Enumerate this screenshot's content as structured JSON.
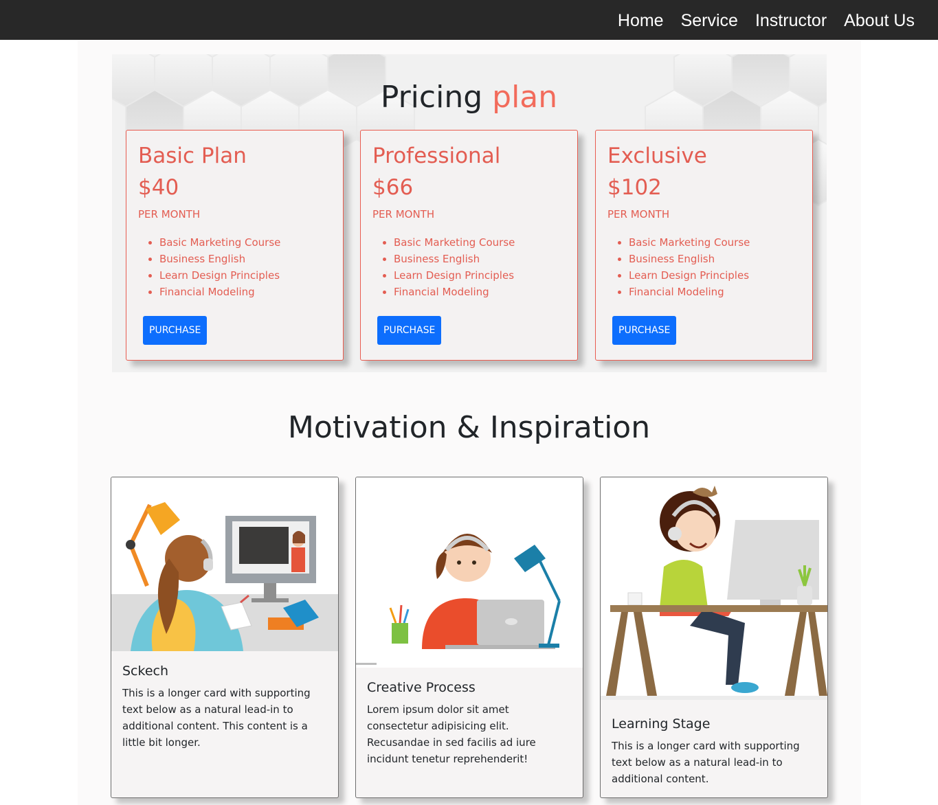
{
  "nav": {
    "items": [
      {
        "label": "Home"
      },
      {
        "label": "Service"
      },
      {
        "label": "Instructor"
      },
      {
        "label": "About Us"
      }
    ]
  },
  "pricing": {
    "title_main": "Pricing",
    "title_accent": "plan",
    "accent_color": "#f26b5b",
    "plans": [
      {
        "name": "Basic Plan",
        "price": "$40",
        "period": "PER MONTH",
        "features": [
          "Basic Marketing Course",
          "Business English",
          "Learn Design Principles",
          "Financial Modeling"
        ],
        "button_label": "PURCHASE"
      },
      {
        "name": "Professional",
        "price": "$66",
        "period": "PER MONTH",
        "features": [
          "Basic Marketing Course",
          "Business English",
          "Learn Design Principles",
          "Financial Modeling"
        ],
        "button_label": "PURCHASE"
      },
      {
        "name": "Exclusive",
        "price": "$102",
        "period": "PER MONTH",
        "features": [
          "Basic Marketing Course",
          "Business English",
          "Learn Design Principles",
          "Financial Modeling"
        ],
        "button_label": "PURCHASE"
      }
    ]
  },
  "motivation": {
    "title": "Motivation & Inspiration",
    "cards": [
      {
        "title": "Sckech",
        "text": "This is a longer card with supporting text below as a natural lead-in to additional content. This content is a little bit longer."
      },
      {
        "title": "Creative Process",
        "text": "Lorem ipsum dolor sit amet consectetur adipisicing elit. Recusandae in sed facilis ad iure incidunt tenetur reprehenderit!"
      },
      {
        "title": "Learning Stage",
        "text": "This is a longer card with supporting text below as a natural lead-in to additional content."
      }
    ]
  }
}
